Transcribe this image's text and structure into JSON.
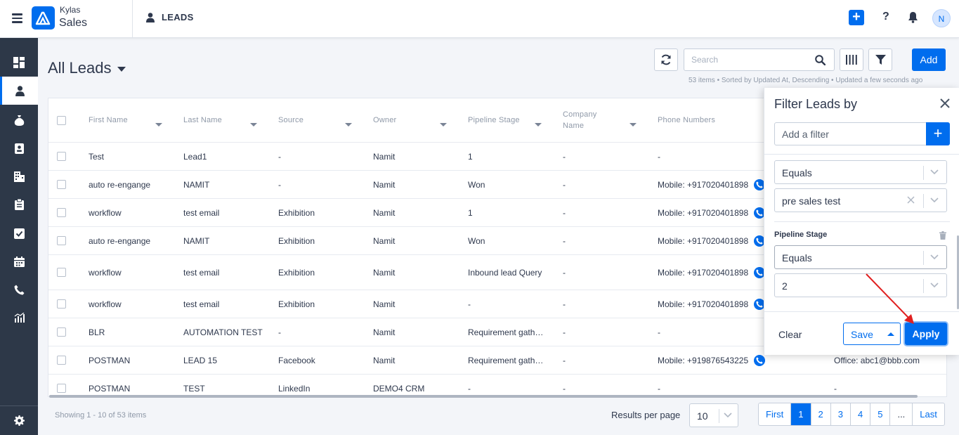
{
  "app": {
    "brand_top": "Kylas",
    "brand_main": "Sales",
    "module": "LEADS",
    "avatar_initial": "N"
  },
  "page": {
    "title": "All Leads",
    "search_placeholder": "Search",
    "add_label": "Add",
    "meta": "53 items • Sorted by Updated At, Descending • Updated a few seconds ago"
  },
  "table": {
    "headers": {
      "first_name": "First Name",
      "last_name": "Last Name",
      "source": "Source",
      "owner": "Owner",
      "pipeline_stage": "Pipeline Stage",
      "company_name_1": "Company",
      "company_name_2": "Name",
      "phone_numbers": "Phone Numbers"
    },
    "rows": [
      {
        "first": "Test",
        "last": "Lead1",
        "source": "-",
        "owner": "Namit",
        "stage": "1",
        "company": "-",
        "phone": "-",
        "phone_icon": false,
        "extra": ""
      },
      {
        "first": "auto re-engange",
        "last": "NAMIT",
        "source": "-",
        "owner": "Namit",
        "stage": "Won",
        "company": "-",
        "phone": "Mobile: +917020401898",
        "phone_icon": true,
        "extra": ""
      },
      {
        "first": "workflow",
        "last": "test email",
        "source": "Exhibition",
        "owner": "Namit",
        "stage": "1",
        "company": "-",
        "phone": "Mobile: +917020401898",
        "phone_icon": true,
        "extra": ""
      },
      {
        "first": "auto re-engange",
        "last": "NAMIT",
        "source": "Exhibition",
        "owner": "Namit",
        "stage": "Won",
        "company": "-",
        "phone": "Mobile: +917020401898",
        "phone_icon": true,
        "extra": ""
      },
      {
        "first": "workflow",
        "last": "test email",
        "source": "Exhibition",
        "owner": "Namit",
        "stage": "Inbound lead Query",
        "company": "-",
        "phone": "Mobile: +917020401898",
        "phone_icon": true,
        "extra": ""
      },
      {
        "first": "workflow",
        "last": "test email",
        "source": "Exhibition",
        "owner": "Namit",
        "stage": "-",
        "company": "-",
        "phone": "Mobile: +917020401898",
        "phone_icon": true,
        "extra": ""
      },
      {
        "first": "BLR",
        "last": "AUTOMATION TEST",
        "source": "-",
        "owner": "Namit",
        "stage": "Requirement gath…",
        "company": "-",
        "phone": "-",
        "phone_icon": false,
        "extra": ""
      },
      {
        "first": "POSTMAN",
        "last": "LEAD 15",
        "source": "Facebook",
        "owner": "Namit",
        "stage": "Requirement gath…",
        "company": "-",
        "phone": "Mobile: +919876543225",
        "phone_icon": true,
        "extra": "Office: abc1@bbb.com"
      },
      {
        "first": "POSTMAN",
        "last": "TEST",
        "source": "LinkedIn",
        "owner": "DEMO4 CRM",
        "stage": "-",
        "company": "-",
        "phone": "-",
        "phone_icon": false,
        "extra": "-"
      }
    ]
  },
  "footer": {
    "showing": "Showing 1 - 10 of 53 items",
    "rpp_label": "Results per page",
    "rpp_value": "10",
    "pages": [
      "First",
      "1",
      "2",
      "3",
      "4",
      "5",
      "...",
      "Last"
    ],
    "active_page": "1"
  },
  "filter": {
    "title": "Filter Leads by",
    "add_placeholder": "Add a filter",
    "operator_1": "Equals",
    "value_1": "pre sales test",
    "field_2": "Pipeline Stage",
    "operator_2": "Equals",
    "value_2": "2",
    "clear": "Clear",
    "save": "Save",
    "apply": "Apply"
  },
  "colors": {
    "accent": "#006DEE",
    "sidebar": "#2d3848",
    "annotation": "#e02020"
  }
}
